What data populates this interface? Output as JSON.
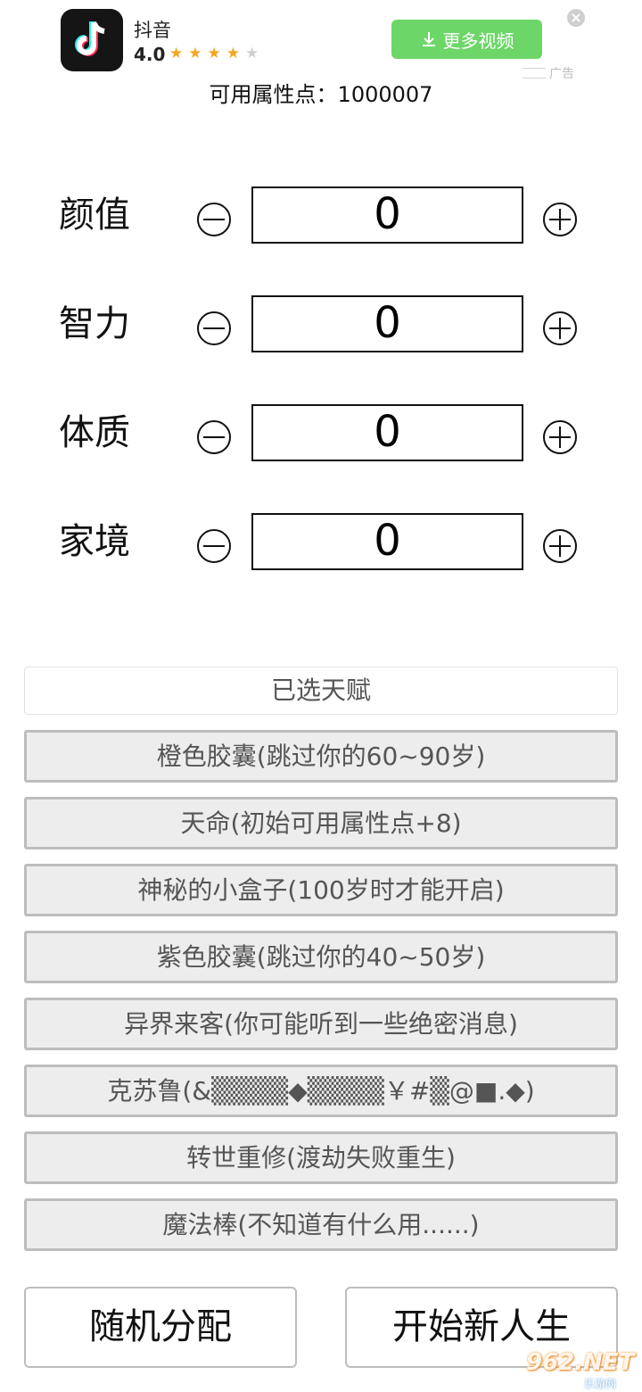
{
  "ad": {
    "app_name": "抖音",
    "rating": "4.0",
    "stars_filled": 4,
    "stars_total": 5,
    "button_label": "更多视频",
    "ad_label": "广告",
    "icon": "tiktok-logo-icon",
    "accent_color": "#6dd668"
  },
  "points": {
    "label": "可用属性点：",
    "value": "1000007"
  },
  "attributes": [
    {
      "label": "颜值",
      "value": "0"
    },
    {
      "label": "智力",
      "value": "0"
    },
    {
      "label": "体质",
      "value": "0"
    },
    {
      "label": "家境",
      "value": "0"
    }
  ],
  "talents": {
    "header": "已选天赋",
    "items": [
      "橙色胶囊(跳过你的60~90岁)",
      "天命(初始可用属性点+8)",
      "神秘的小盒子(100岁时才能开启)",
      "紫色胶囊(跳过你的40~50岁)",
      "异界来客(你可能听到一些绝密消息)",
      "克苏鲁(&▒▒▒▒◆▒▒▒▒￥#▒@■.◆)",
      "转世重修(渡劫失败重生)",
      "魔法棒(不知道有什么用......)"
    ]
  },
  "buttons": {
    "random": "随机分配",
    "start": "开始新人生"
  },
  "watermark": {
    "main": "962.NET",
    "sub": "乐游网"
  }
}
